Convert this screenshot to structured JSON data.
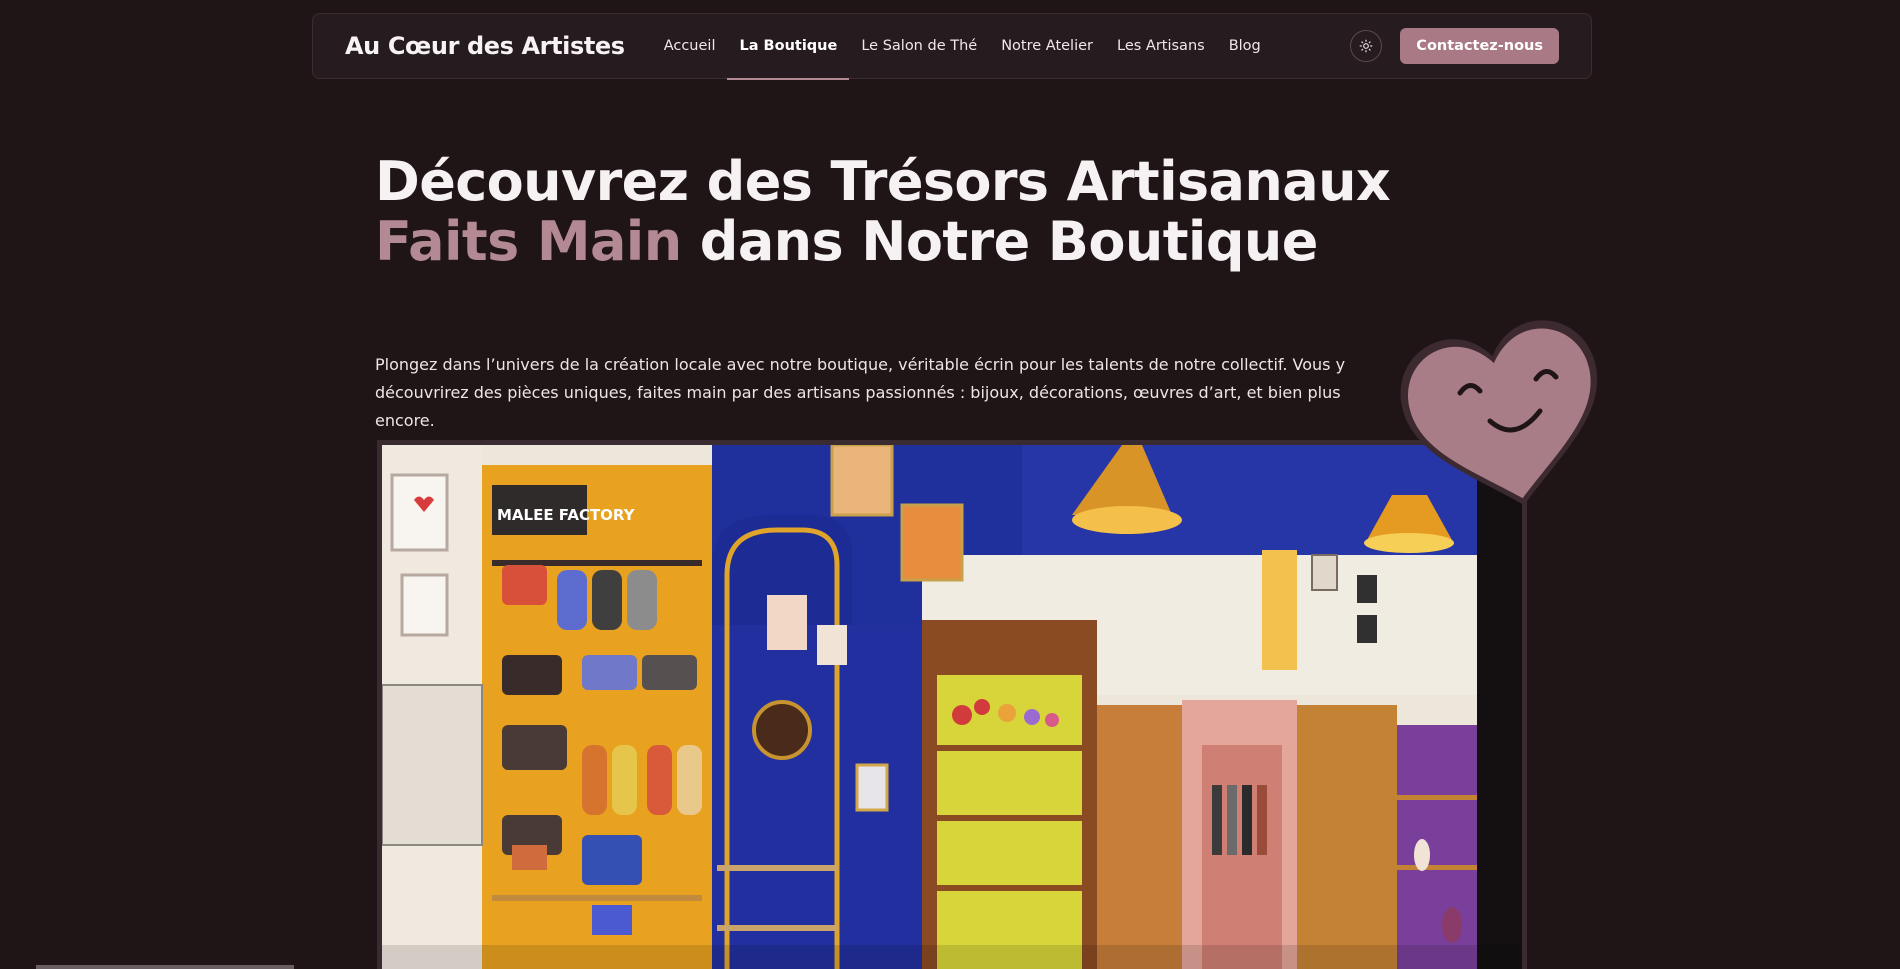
{
  "brand": {
    "name": "Au Cœur des Artistes"
  },
  "nav": {
    "items": [
      {
        "label": "Accueil",
        "active": false
      },
      {
        "label": "La Boutique",
        "active": true
      },
      {
        "label": "Le Salon de Thé",
        "active": false
      },
      {
        "label": "Notre Atelier",
        "active": false
      },
      {
        "label": "Les Artisans",
        "active": false
      },
      {
        "label": "Blog",
        "active": false
      }
    ],
    "theme_icon": "sun-icon",
    "contact_label": "Contactez-nous"
  },
  "hero": {
    "title_line1": "Découvrez des Trésors Artisanaux",
    "title_accent": "Faits Main",
    "title_rest": "dans Notre Boutique",
    "intro": "Plongez dans l’univers de la création locale avec notre boutique, véritable écrin pour les talents de notre collectif. Vous y découvrirez des pièces uniques, faites main par des artisans passionnés : bijoux, décorations, œuvres d’art, et bien plus encore.",
    "photo_signage": "MALEE FACTORY"
  },
  "decoration": {
    "icon": "smiling-heart-icon"
  },
  "colors": {
    "background": "#1f1517",
    "navbar": "#261b1e",
    "accent": "#b38994",
    "button": "#a97a86"
  }
}
